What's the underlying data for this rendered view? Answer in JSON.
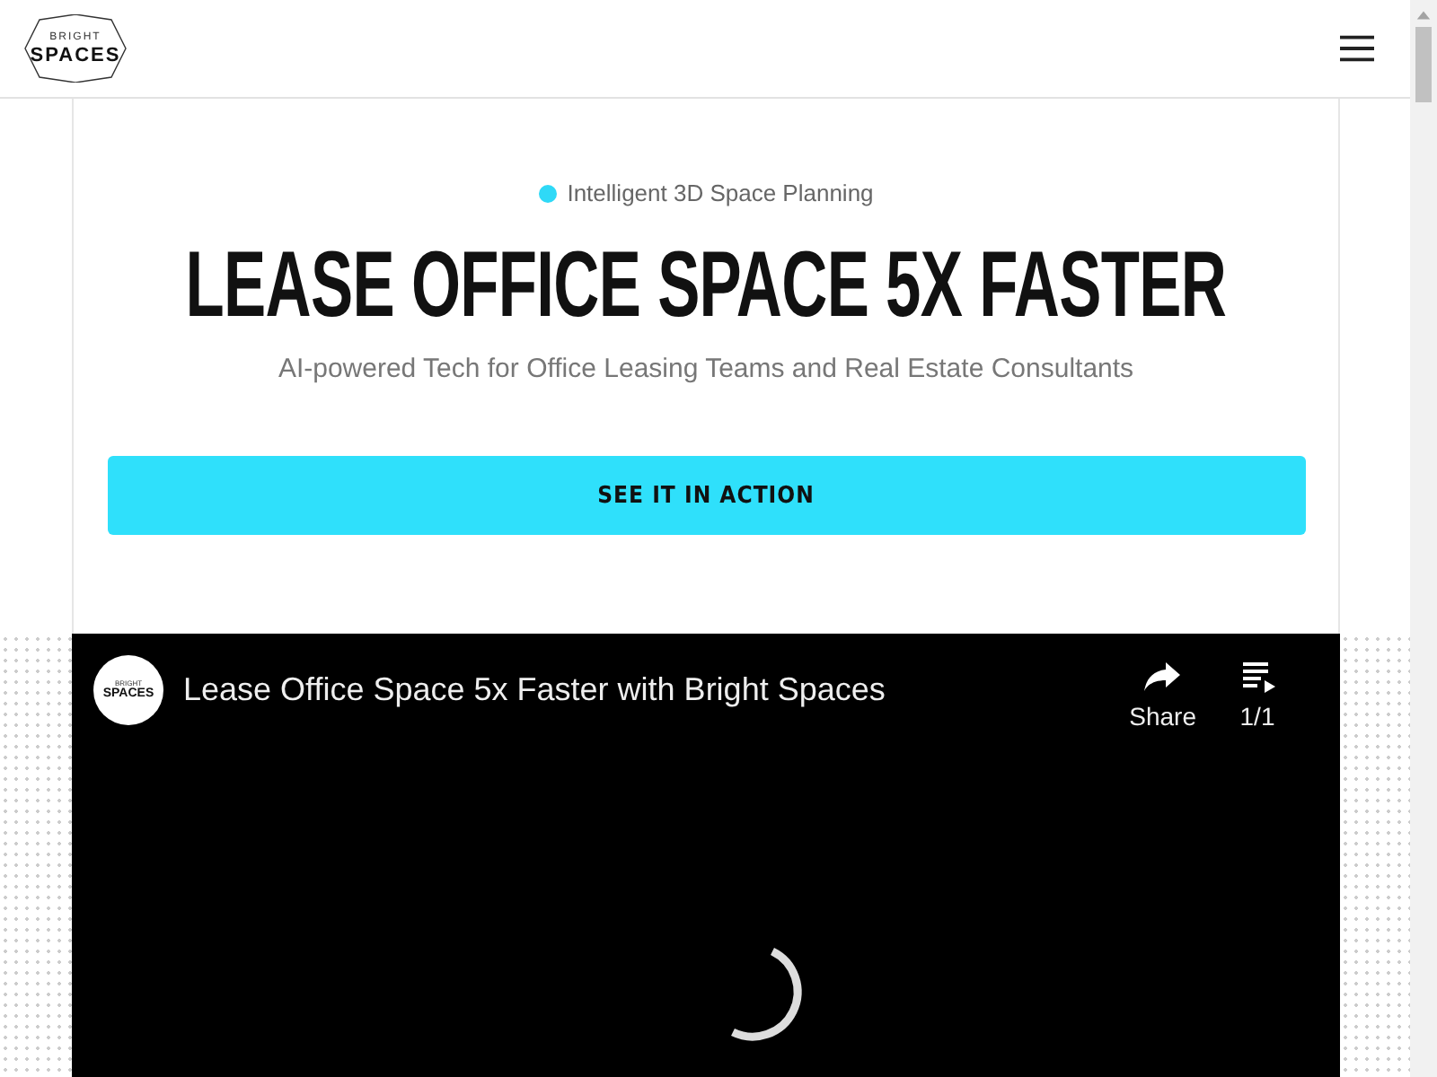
{
  "header": {
    "logo": {
      "top": "BRIGHT",
      "bottom": "SPACES"
    }
  },
  "hero": {
    "tagline": "Intelligent 3D Space Planning",
    "title": "LEASE OFFICE SPACE 5X FASTER",
    "subtitle": "AI-powered Tech for Office Leasing Teams and Real Estate Consultants",
    "cta": "SEE IT IN ACTION"
  },
  "video": {
    "channel_logo": {
      "top": "BRIGHT",
      "bottom": "SPACES"
    },
    "title": "Lease Office Space 5x Faster with Bright Spaces",
    "actions": [
      {
        "kind": "share",
        "label": "Share"
      },
      {
        "kind": "playlist",
        "label": "1/1"
      }
    ]
  }
}
